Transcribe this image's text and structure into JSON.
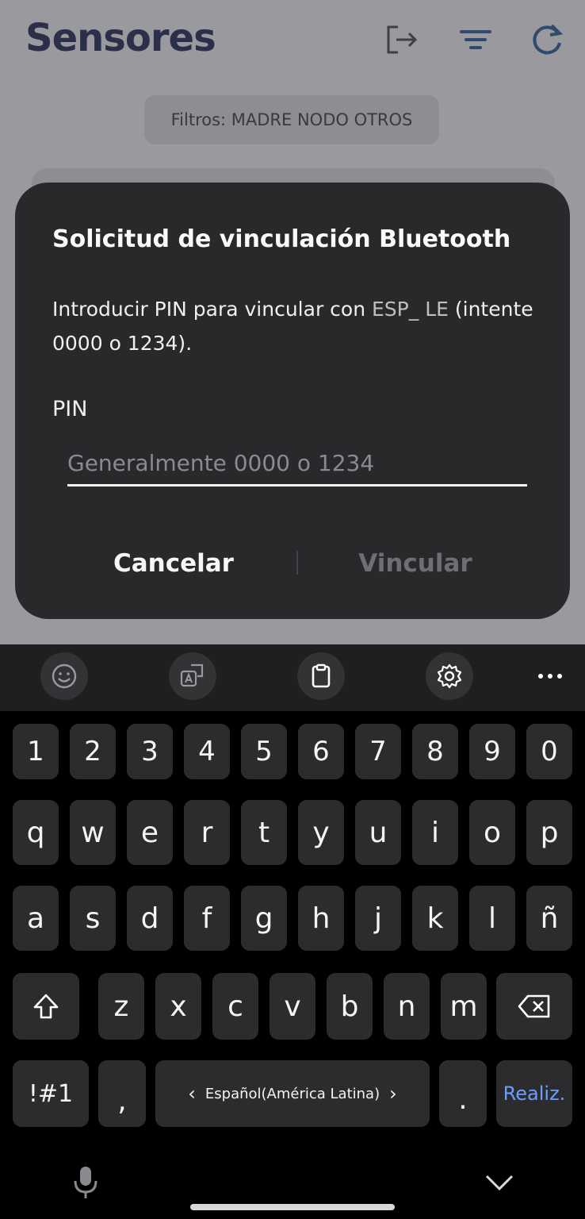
{
  "app": {
    "title": "Sensores",
    "filter_label": "Filtros: MADRE NODO OTROS",
    "header_icons": [
      "logout-icon",
      "filter-icon",
      "refresh-icon"
    ]
  },
  "dialog": {
    "title": "Solicitud de vinculación Bluetooth",
    "message_prefix": "Introducir PIN para vincular con ",
    "device_name": "ESP_ LE",
    "message_suffix": " (intente 0000 o 1234).",
    "pin_label": "PIN",
    "pin_placeholder": "Generalmente 0000 o 1234",
    "pin_value": "",
    "cancel_label": "Cancelar",
    "link_label": "Vincular"
  },
  "keyboard": {
    "toolbar_icons": [
      "emoji-icon",
      "translate-icon",
      "clipboard-icon",
      "settings-icon",
      "more-icon"
    ],
    "row1": [
      "1",
      "2",
      "3",
      "4",
      "5",
      "6",
      "7",
      "8",
      "9",
      "0"
    ],
    "row2": [
      "q",
      "w",
      "e",
      "r",
      "t",
      "y",
      "u",
      "i",
      "o",
      "p"
    ],
    "row3": [
      "a",
      "s",
      "d",
      "f",
      "g",
      "h",
      "j",
      "k",
      "l",
      "ñ"
    ],
    "row4": [
      "z",
      "x",
      "c",
      "v",
      "b",
      "n",
      "m"
    ],
    "symbols_label": "!#1",
    "comma": ",",
    "language_label": "Español(América Latina)",
    "period": ".",
    "done_label": "Realiz.",
    "done_color": "#6c9dfd"
  },
  "colors": {
    "dialog_bg": "#29292c",
    "key_bg": "#2c2c2f",
    "app_title": "#2c2f4a"
  }
}
